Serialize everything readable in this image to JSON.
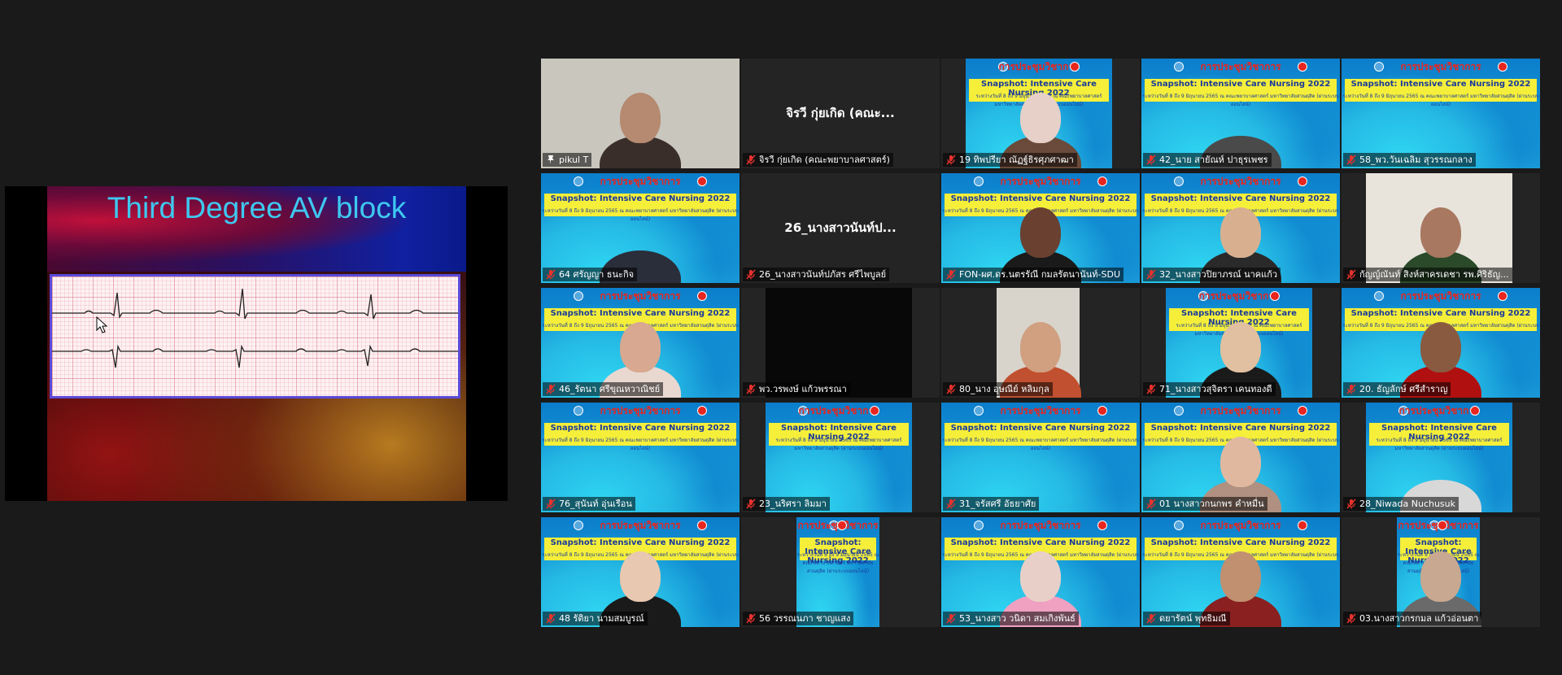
{
  "share": {
    "slide_title": "Third Degree AV block"
  },
  "banner": {
    "heading": "การประชุมวิชาการ",
    "subtitle": "Snapshot: Intensive Care Nursing 2022",
    "detail": "ระหว่างวันที่ 8 ถึง 9 มิถุนายน 2565 ณ คณะพยาบาลศาสตร์ มหาวิทยาลัยสวนดุสิต (ผ่านระบบออนไลน์)"
  },
  "participants": [
    {
      "name": "pikul T",
      "display": ""
    },
    {
      "name": "จิรวี กุ่ยเกิด (คณะพยาบาลศาสตร์)",
      "display": "จิรวี กุ่ยเกิด (คณะ..."
    },
    {
      "name": "19 ทิพปรียา ณัฏฐ์ธิรศุภศาฒา",
      "display": ""
    },
    {
      "name": "42_นาย สายัณห์ ปาธุรเพชร",
      "display": ""
    },
    {
      "name": "58_พว.วันเฉลิม สุวรรณกลาง",
      "display": ""
    },
    {
      "name": "64 ศรัญญา ธนะกิจ",
      "display": ""
    },
    {
      "name": "26_นางสาวนันท์ปภัสร ศรีไพบูลย์",
      "display": "26_นางสาวนันท์ป..."
    },
    {
      "name": "FON-ผศ.ดร.นตรรัณี กมลรัตนานันท์-SDU",
      "display": ""
    },
    {
      "name": "32_นางสาวปิยาภรณ์ นาคแก้ว",
      "display": ""
    },
    {
      "name": "กัญญ์ณันท์ สิงห์สาครเดชา รพ.ศิริธัญ...",
      "display": ""
    },
    {
      "name": "46_รัตนา ศรีขุณหวาณิชย์",
      "display": ""
    },
    {
      "name": "พว.วรพงษ์ แก้วพรรณา",
      "display": ""
    },
    {
      "name": "80_นาง อุษณีย์ หลิมกุล",
      "display": ""
    },
    {
      "name": "71_นางสาวสุจิตรา เคนทองดี",
      "display": ""
    },
    {
      "name": "20. ธัญลักษ์ ศรีสำราญ",
      "display": ""
    },
    {
      "name": "76_สุนันท์ อุ่นเรือน",
      "display": ""
    },
    {
      "name": "23_นริศรา ลิมมา",
      "display": ""
    },
    {
      "name": "31_จรัสศรี อัธยาศัย",
      "display": ""
    },
    {
      "name": "01 นางสาวกนกพร คำหมื่น",
      "display": ""
    },
    {
      "name": "28_Niwada Nuchusuk",
      "display": ""
    },
    {
      "name": "48 รัติยา นามสมบูรณ์",
      "display": ""
    },
    {
      "name": "56 วรรณนภา ชาญแสง",
      "display": ""
    },
    {
      "name": "53_นางสาว วนิดา สมเกิงพันธ์",
      "display": ""
    },
    {
      "name": "ดยารัตน์ พุทธิมณี",
      "display": ""
    },
    {
      "name": "03.นางสาวกรกมล แก้วอ่อนตา",
      "display": ""
    }
  ],
  "colors": {
    "background": "#1a1a1a",
    "active_speaker_border": "#e8e26a",
    "slide_title": "#3ec8f0",
    "mic_off": "#e8322c"
  }
}
